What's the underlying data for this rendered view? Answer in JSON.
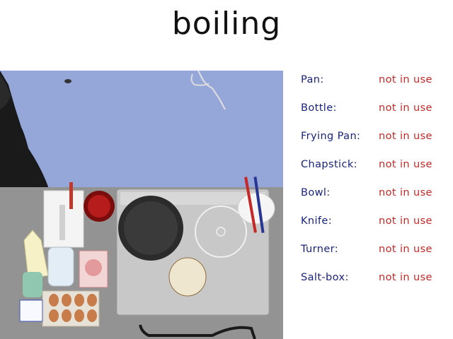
{
  "action_label": "boiling",
  "colors": {
    "tool_name": "#1a237e",
    "tool_state": "#c62828"
  },
  "tools": [
    {
      "name": "Pan:",
      "state": "not in use"
    },
    {
      "name": "Bottle:",
      "state": "not in use"
    },
    {
      "name": "Frying Pan:",
      "state": "not in use"
    },
    {
      "name": "Chapstick:",
      "state": "not in use"
    },
    {
      "name": "Bowl:",
      "state": "not in use"
    },
    {
      "name": "Knife:",
      "state": "not in use"
    },
    {
      "name": "Turner:",
      "state": "not in use"
    },
    {
      "name": "Salt-box:",
      "state": "not in use"
    }
  ]
}
